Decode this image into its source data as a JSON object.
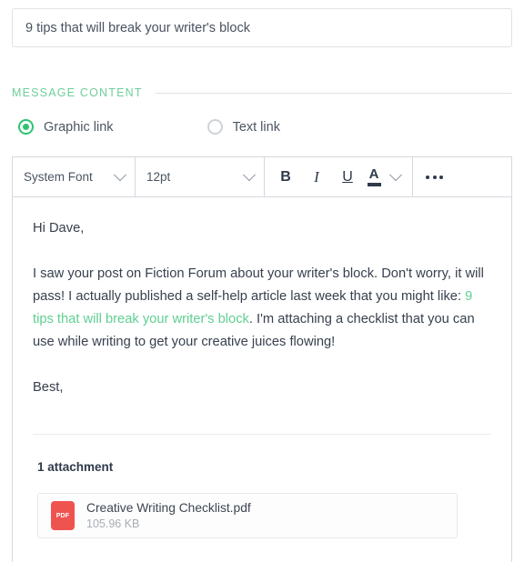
{
  "title_field": {
    "value": "9 tips that will break your writer's block",
    "placeholder": "Title"
  },
  "section": {
    "header": "MESSAGE CONTENT",
    "accent_color": "#6ecf9a"
  },
  "link_type": {
    "options": [
      {
        "label": "Graphic link",
        "selected": true
      },
      {
        "label": "Text link",
        "selected": false
      }
    ],
    "selected_color": "#2ec46f"
  },
  "toolbar": {
    "font_family": "System Font",
    "font_size": "12pt",
    "bold_label": "B",
    "italic_label": "I",
    "underline_label": "U",
    "text_color_label": "A",
    "more_label": "•••",
    "icons": {
      "font_chevron": "chevron-down-icon",
      "size_chevron": "chevron-down-icon",
      "color_chevron": "chevron-down-icon",
      "more": "ellipsis-icon"
    }
  },
  "message": {
    "greeting": "Hi Dave,",
    "paragraph_before_link": "I saw your post on Fiction Forum about your writer's block. Don't worry, it will pass! I actually published a self-help article last week that you might like: ",
    "link_text": "9 tips that will break your writer's block",
    "paragraph_after_link": ". I'm attaching a checklist that you can use while writing to get your creative juices flowing!",
    "signoff": "Best,",
    "link_color": "#5fcf92"
  },
  "attachments": {
    "heading": "1 attachment",
    "items": [
      {
        "name": "Creative Writing Checklist.pdf",
        "size": "105.96 KB",
        "type_badge": "PDF",
        "badge_color": "#ef5350"
      }
    ]
  }
}
